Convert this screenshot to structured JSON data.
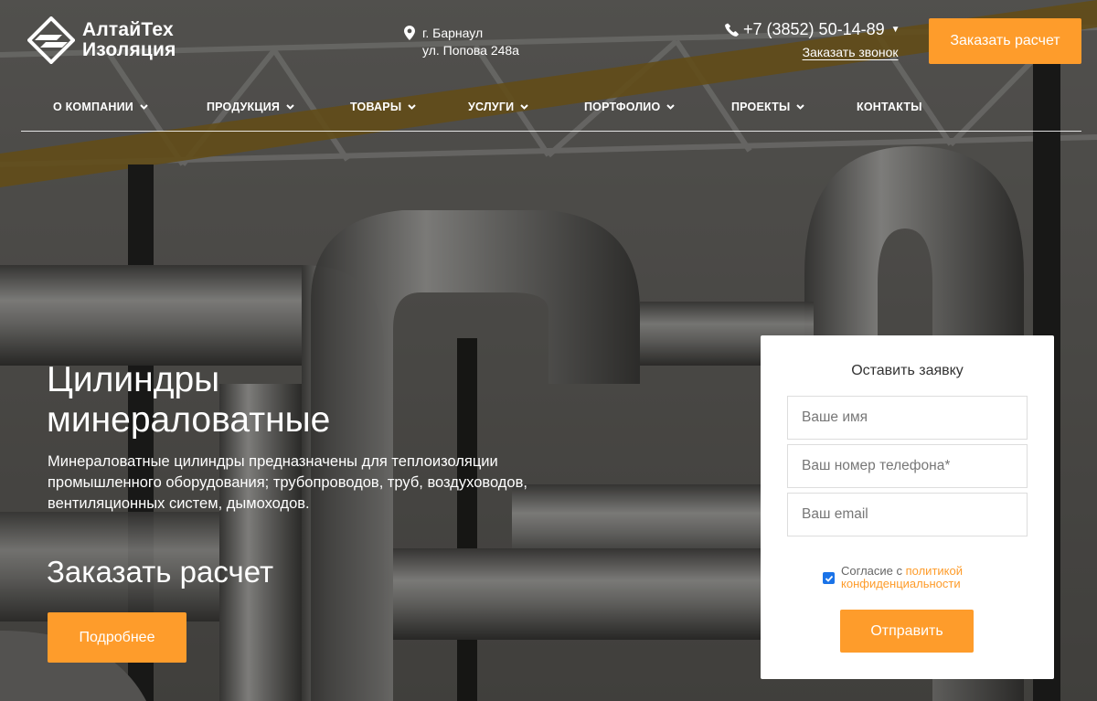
{
  "logo": {
    "line1": "АлтайТех",
    "line2": "Изоляция"
  },
  "address": {
    "city": "г. Барнаул",
    "street": "ул. Попова 248а"
  },
  "phone": {
    "number": "+7 (3852) 50-14-89",
    "callback": "Заказать звонок"
  },
  "header_cta": "Заказать расчет",
  "nav": [
    {
      "label": "О КОМПАНИИ",
      "dropdown": true
    },
    {
      "label": "ПРОДУКЦИЯ",
      "dropdown": true
    },
    {
      "label": "ТОВАРЫ",
      "dropdown": true
    },
    {
      "label": "УСЛУГИ",
      "dropdown": true
    },
    {
      "label": "ПОРТФОЛИО",
      "dropdown": true
    },
    {
      "label": "ПРОЕКТЫ",
      "dropdown": true
    },
    {
      "label": "КОНТАКТЫ",
      "dropdown": false
    }
  ],
  "hero": {
    "title_line1": "Цилиндры",
    "title_line2": "минераловатные",
    "description": "Минераловатные цилиндры предназначены для теплоизоляции промышленного оборудования; трубопроводов, труб, воздуховодов, вентиляционных систем, дымоходов.",
    "subtitle": "Заказать расчет",
    "button": "Подробнее"
  },
  "form": {
    "title": "Оставить заявку",
    "name_placeholder": "Ваше имя",
    "phone_placeholder": "Ваш номер телефона*",
    "email_placeholder": "Ваш email",
    "consent_prefix": "Согласие с ",
    "consent_link_1": "политикой",
    "consent_link_2": "конфиденциальности",
    "consent_checked": true,
    "submit": "Отправить"
  },
  "colors": {
    "accent": "#fe9c2b",
    "checkbox": "#1a73e8"
  },
  "icons": [
    "logo-mark-icon",
    "map-pin-icon",
    "phone-icon",
    "chevron-down-icon",
    "check-icon"
  ]
}
